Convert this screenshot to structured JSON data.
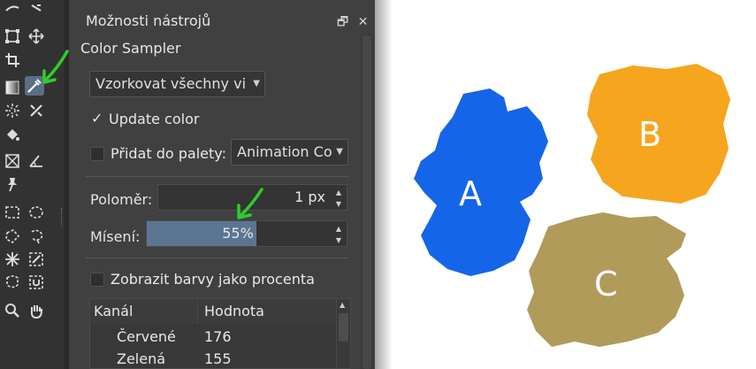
{
  "toolbox": {
    "tools": [
      "freehand-icon",
      "transform-icon",
      "move-icon",
      "crop-icon",
      "gradient-icon",
      "color-sampler-icon",
      "smart-patch-icon",
      "multibrush-icon",
      "fill-icon",
      "assistant-icon",
      "measure-icon",
      "reference-icon",
      "rect-select-icon",
      "ellipse-select-icon",
      "poly-select-icon",
      "freehand-select-icon",
      "contiguous-select-icon",
      "similar-select-icon",
      "bezier-select-icon",
      "magnetic-select-icon",
      "zoom-icon",
      "pan-icon"
    ]
  },
  "panel": {
    "title": "Možnosti nástrojů",
    "subtitle": "Color Sampler",
    "sample_mode": "Vzorkovat všechny vi",
    "update_color": {
      "label": "Update color",
      "checked": true
    },
    "add_to_palette": {
      "label": "Přidat do palety:",
      "checked": false,
      "palette": "Animation Co"
    },
    "radius": {
      "label": "Poloměr:",
      "value": "1 px"
    },
    "blend": {
      "label": "Mísení:",
      "value": "55%",
      "percent": 55
    },
    "show_percent": {
      "label": "Zobrazit barvy jako procenta",
      "checked": false
    },
    "table": {
      "headers": [
        "Kanál",
        "Hodnota"
      ],
      "rows": [
        {
          "channel": "Červené",
          "value": "176"
        },
        {
          "channel": "Zelená",
          "value": "155"
        }
      ]
    }
  },
  "swatches": [
    {
      "label": "A",
      "color": "#1565e8"
    },
    {
      "label": "B",
      "color": "#f5a51e"
    },
    {
      "label": "C",
      "color": "#b09b5b"
    }
  ],
  "accent": "#2ecc2e"
}
